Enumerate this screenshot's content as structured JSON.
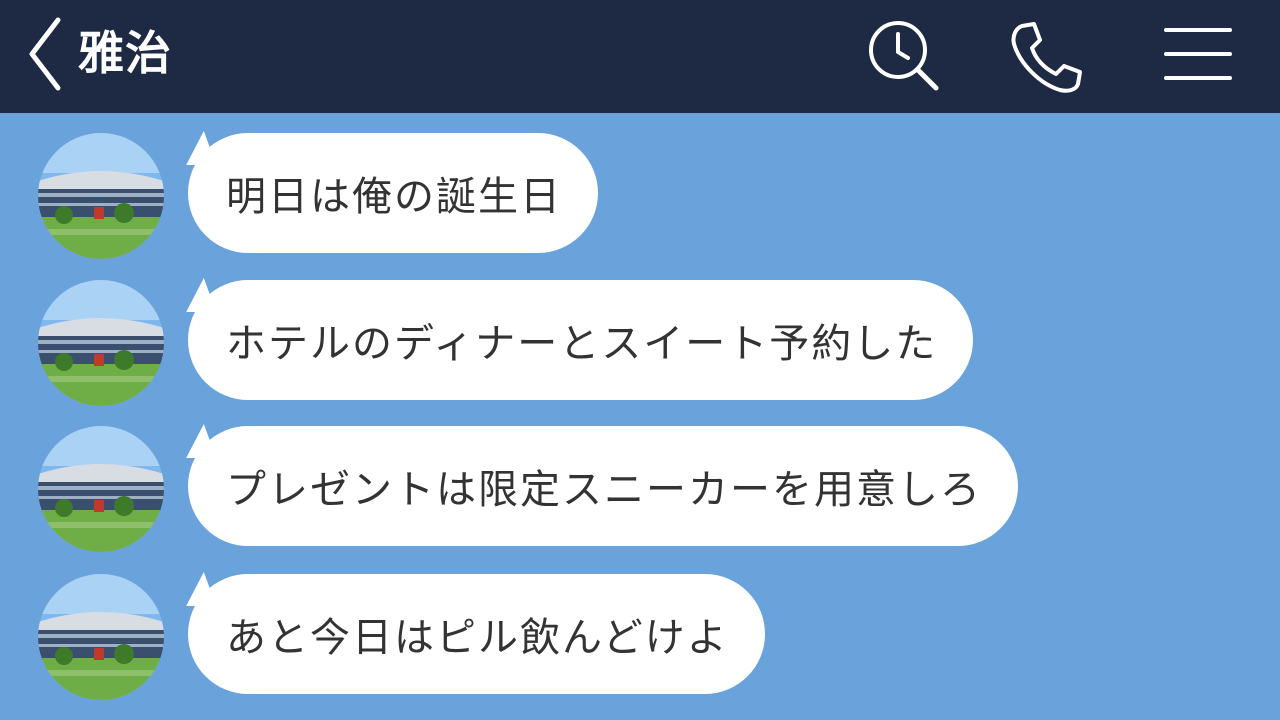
{
  "header": {
    "title": "雅治",
    "back_icon": "chevron-left-icon",
    "search_icon": "search-clock-icon",
    "call_icon": "phone-icon",
    "menu_icon": "hamburger-menu-icon",
    "background": "#1e2943"
  },
  "chat": {
    "background": "#6aa3dc",
    "contact_avatar": "stadium-photo-avatar",
    "messages": [
      {
        "text": "明日は俺の誕生日"
      },
      {
        "text": "ホテルのディナーとスイート予約した"
      },
      {
        "text": "プレゼントは限定スニーカーを用意しろ"
      },
      {
        "text": "あと今日はピル飲んどけよ"
      }
    ]
  }
}
